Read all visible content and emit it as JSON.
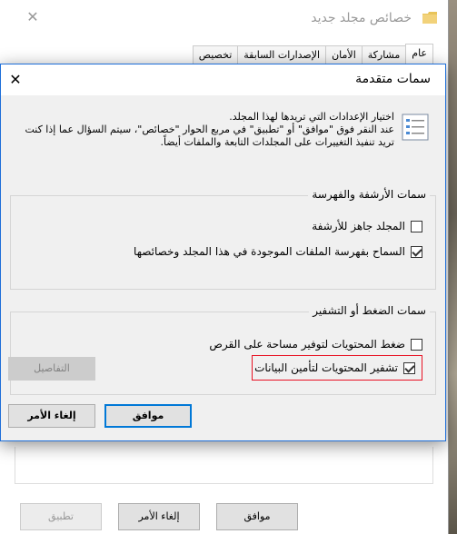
{
  "back_window": {
    "title": "خصائص مجلد جديد",
    "tabs": [
      "عام",
      "مشاركة",
      "الأمان",
      "الإصدارات السابقة",
      "تخصيص"
    ],
    "buttons": {
      "ok": "موافق",
      "cancel": "إلغاء الأمر",
      "apply": "تطبيق"
    }
  },
  "dialog": {
    "title": "سمات متقدمة",
    "intro_line1": "اختيار الإعدادات التي تريدها لهذا المجلد.",
    "intro_line2": "عند النقر فوق \"موافق\" أو \"تطبيق\" في مربع الحوار \"خصائص\"، سيتم السؤال عما إذا كنت",
    "intro_line3": "تريد تنفيذ التغييرات على المجلدات التابعة والملفات أيضاً.",
    "archive_group": {
      "label": "سمات الأرشفة والفهرسة",
      "items": [
        {
          "label": "المجلد جاهز للأرشفة",
          "checked": false
        },
        {
          "label": "السماح بفهرسة الملفات الموجودة في هذا المجلد وخصائصها",
          "checked": true
        }
      ]
    },
    "compress_group": {
      "label": "سمات الضغط أو التشفير",
      "items": [
        {
          "label": "ضغط المحتويات لتوفير مساحة على القرص",
          "checked": false
        },
        {
          "label": "تشفير المحتويات لتأمين البيانات",
          "checked": true
        }
      ]
    },
    "details_button": "التفاصيل",
    "ok_button": "موافق",
    "cancel_button": "إلغاء الأمر"
  },
  "colors": {
    "accent": "#0078d7",
    "highlight_border": "#e81123"
  }
}
